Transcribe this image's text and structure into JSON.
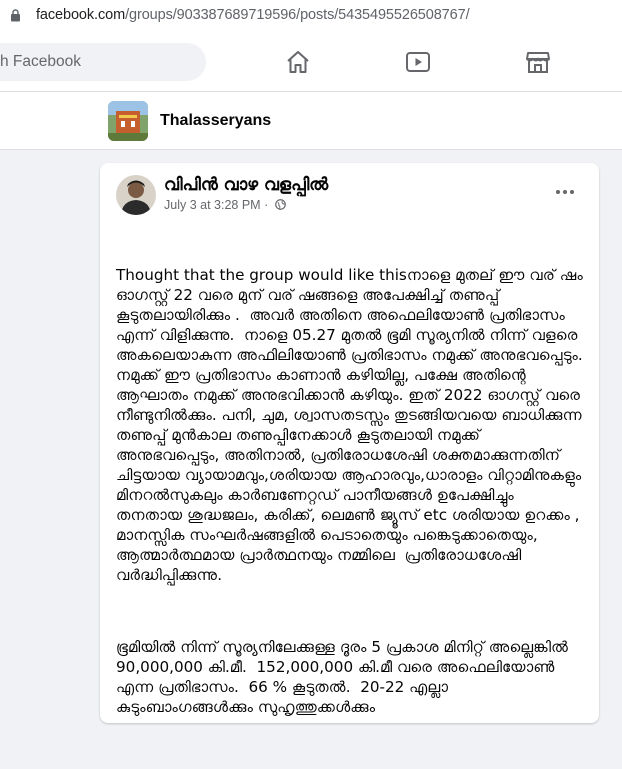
{
  "browser": {
    "url_host": "facebook.com",
    "url_path": "/groups/903387689719596/posts/5435495526508767/"
  },
  "fbnav": {
    "search_placeholder": "h Facebook",
    "icons": [
      "home-icon",
      "watch-icon",
      "marketplace-icon"
    ]
  },
  "group": {
    "name": "Thalasseryans"
  },
  "post": {
    "author": "വിപിൻ വാഴ വളപ്പിൽ",
    "date": "July 3 at 3:28 PM",
    "separator": "·",
    "paragraph1": "Thought that the group would like thisനാളെ മുതല് ഈ വര് ഷം ഓഗസ്റ്റ് 22 വരെ മുന് വര് ഷങ്ങളെ അപേക്ഷിച്ച് തണുപ്പ് കൂടുതലായിരിക്കും .  അവർ അതിനെ അഫെലിയോൺ പ്രതിഭാസം എന്ന് വിളിക്കുന്നു.  നാളെ 05.27 മുതൽ ഭൂമി സൂര്യനിൽ നിന്ന് വളരെ അകലെയാകുന്ന അഫിലിയോൺ പ്രതിഭാസം നമുക്ക് അനുഭവപ്പെടും. നമുക്ക് ഈ പ്രതിഭാസം കാണാൻ കഴിയില്ല, പക്ഷേ അതിന്റെ ആഘാതം നമുക്ക് അനുഭവിക്കാൻ കഴിയും. ഇത് 2022 ഓഗസ്റ്റ് വരെ നീണ്ടുനിൽക്കും. പനി, ചുമ, ശ്വാസതടസ്സം തുടങ്ങിയവയെ ബാധിക്കുന്ന തണുപ്പ് മുൻകാല തണുപ്പിനേക്കാൾ കൂടുതലായി നമുക്ക് അനുഭവപ്പെടും, അതിനാൽ, പ്രതിരോധശേഷി ശക്തമാക്കുന്നതിന് ചിട്ടയായ വ്യായാമവും,ശരിയായ ആഹാരവും,ധാരാളം വിറ്റാമിനുകളും മിനറൽസുകലും കാർബണേറ്റഡ് പാനീയങ്ങൾ ഉപേക്ഷിച്ചും തനതായ ശുദ്ധജലം, കരിക്ക്, ലെമൺ ജ്യൂസ് etc ശരിയായ ഉറക്കം , മാനസ്സിക സംഘർഷങ്ങളിൽ പെടാതെയും പങ്കെടുക്കാതെയും, ആത്മാർത്ഥമായ പ്രാർത്ഥനയും നമ്മിലെ  പ്രതിരോധശേഷി വർദ്ധിപ്പിക്കുന്നു.",
    "paragraph2": "ഭൂമിയിൽ നിന്ന് സൂര്യനിലേക്കുള്ള ദൂരം 5 പ്രകാശ മിനിറ്റ് അല്ലെങ്കിൽ 90,000,000 കി.മീ.  152,000,000 കി.മീ വരെ അഫെലിയോൺ എന്ന പ്രതിഭാസം.  66 % കൂടുതൽ.  20-22 എല്ലാ കുടുംബാംഗങ്ങൾക്കും സുഹൃത്തുക്കൾക്കും"
  },
  "colors": {
    "bg": "#f0f2f5",
    "secondary_text": "#65676b",
    "icon": "#65676b"
  }
}
